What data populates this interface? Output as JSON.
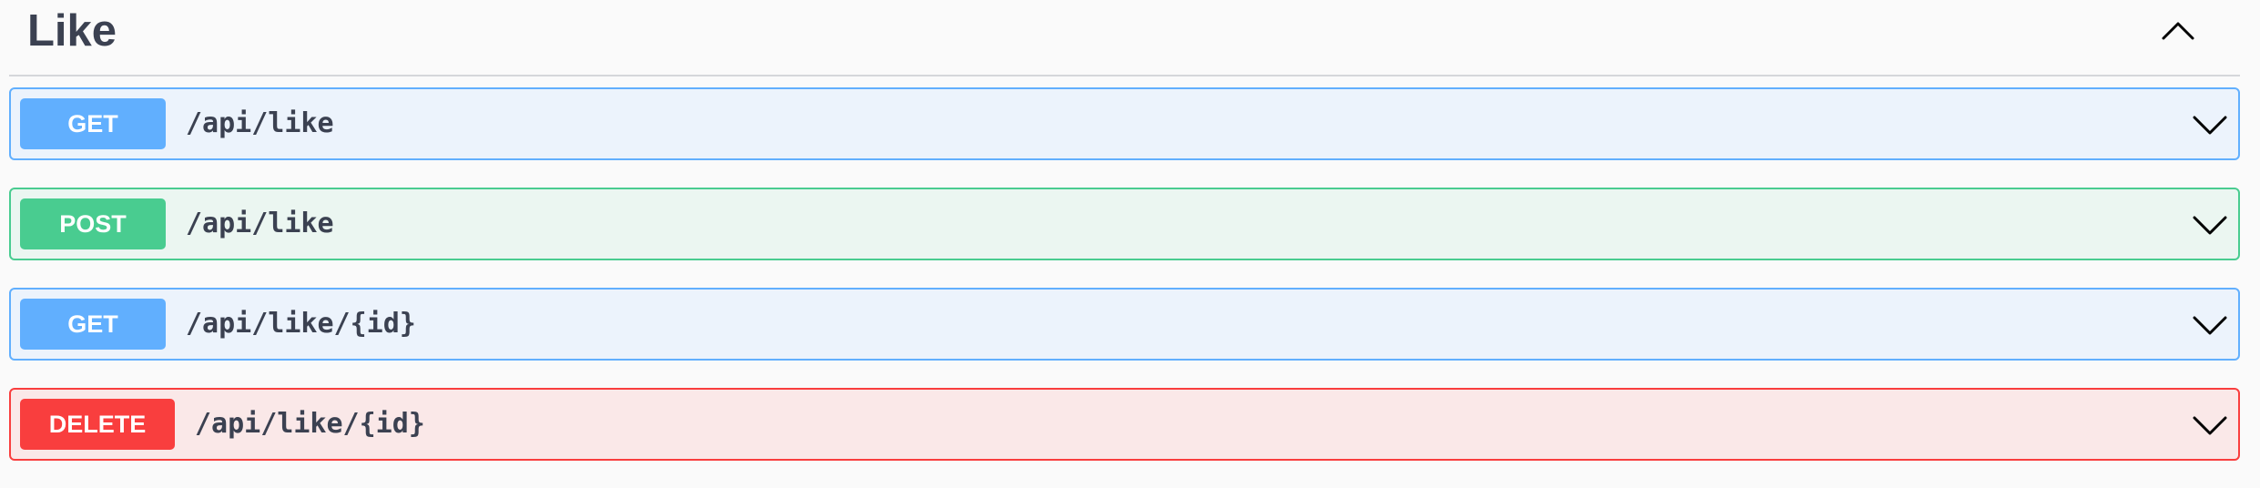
{
  "tag": {
    "title": "Like",
    "collapse_icon": "chevron-up-icon"
  },
  "operations": [
    {
      "method": "GET",
      "path": "/api/like",
      "color": "#61affe",
      "expand_icon": "chevron-down-icon"
    },
    {
      "method": "POST",
      "path": "/api/like",
      "color": "#49cc90",
      "expand_icon": "chevron-down-icon"
    },
    {
      "method": "GET",
      "path": "/api/like/{id}",
      "color": "#61affe",
      "expand_icon": "chevron-down-icon"
    },
    {
      "method": "DELETE",
      "path": "/api/like/{id}",
      "color": "#f93e3e",
      "expand_icon": "chevron-down-icon"
    }
  ]
}
